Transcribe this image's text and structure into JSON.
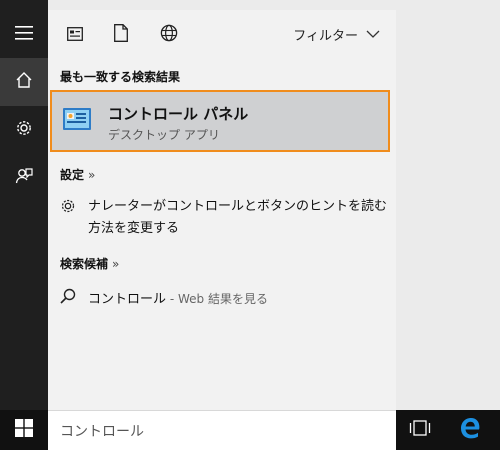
{
  "colors": {
    "rail_bg": "#1f1f1f",
    "panel_bg": "#f2f2f2",
    "highlight_bg": "#cfd0d2",
    "highlight_border": "#f08c1c",
    "taskbar_bg": "#111111",
    "edge_blue": "#1c8fe0"
  },
  "rail": {
    "items": [
      {
        "icon": "hamburger-icon"
      },
      {
        "icon": "home-icon"
      },
      {
        "icon": "gear-icon"
      },
      {
        "icon": "feedback-icon"
      }
    ]
  },
  "topbar": {
    "icons": [
      "document-type-icon",
      "file-icon",
      "globe-icon"
    ],
    "filter_label": "フィルター"
  },
  "best_match": {
    "title": "最も一致する検索結果",
    "app_name": "コントロール パネル",
    "app_type": "デスクトップ アプリ"
  },
  "settings": {
    "title": "設定",
    "arrow": "»",
    "item_text": "ナレーターがコントロールとボタンのヒントを読む方法を変更する"
  },
  "suggestions": {
    "title": "検索候補",
    "arrow": "»",
    "item_text": "コントロール",
    "item_hint": " - Web 結果を見る"
  },
  "taskbar": {
    "search_value": "コントロール",
    "icons": [
      "windows-logo-icon",
      "task-view-icon",
      "edge-icon"
    ]
  }
}
